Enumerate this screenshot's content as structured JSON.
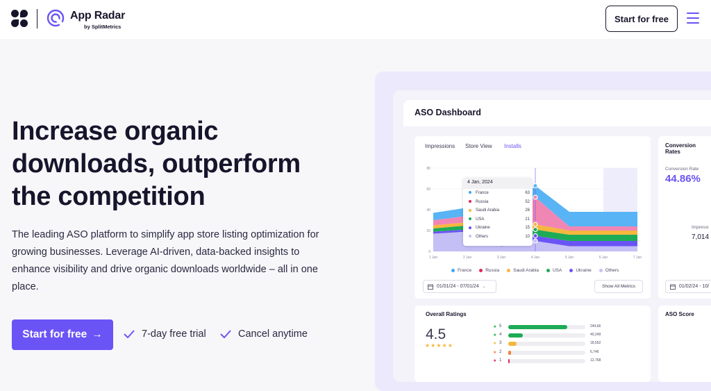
{
  "header": {
    "brand": "App Radar",
    "brand_sub": "by SplitMetrics",
    "cta": "Start for free"
  },
  "hero": {
    "title": "Increase organic downloads, outperform the competition",
    "description": "The leading ASO platform to simplify app store listing optimization for growing businesses. Leverage AI-driven, data-backed insights to enhance visibility and drive organic downloads worldwide – all in one place.",
    "cta": "Start for free",
    "perks": [
      "7-day free trial",
      "Cancel anytime"
    ]
  },
  "dashboard": {
    "title": "ASO Dashboard",
    "tabs": [
      "Impressions",
      "Store View",
      "Installs"
    ],
    "active_tab": "Installs",
    "date_range": "01/01/24 - 07/01/24",
    "show_all": "Show All Metrics",
    "tooltip": {
      "date": "4 Jan, 2024",
      "rows": [
        {
          "label": "France",
          "value": "63",
          "color": "#3da8f5"
        },
        {
          "label": "Russia",
          "value": "52",
          "color": "#e02658"
        },
        {
          "label": "Saudi Arabia",
          "value": "26",
          "color": "#f5b73d"
        },
        {
          "label": "USA",
          "value": "21",
          "color": "#1eab57"
        },
        {
          "label": "Ukraine",
          "value": "15",
          "color": "#6a54f5"
        },
        {
          "label": "Others",
          "value": "10",
          "color": "#c4bff5"
        }
      ]
    },
    "legend": [
      "France",
      "Russia",
      "Saudi Arabia",
      "USA",
      "Ukraine",
      "Others"
    ],
    "conversion": {
      "title": "Conversion Rates",
      "label": "Conversion Rate",
      "value": "44.86%",
      "impressions_label": "Impressi",
      "impressions_value": "7,014",
      "date": "01/02/24 - 10/"
    },
    "ratings": {
      "title": "Overall Ratings",
      "score": "4.5",
      "rows": [
        {
          "stars": "5",
          "count": "244,66",
          "fraction": 0.77,
          "color": "#1eab57"
        },
        {
          "stars": "4",
          "count": "40,249",
          "fraction": 0.19,
          "color": "#1eab57"
        },
        {
          "stars": "3",
          "count": "18,552",
          "fraction": 0.11,
          "color": "#f5b73d"
        },
        {
          "stars": "2",
          "count": "6,746",
          "fraction": 0.04,
          "color": "#f5803d"
        },
        {
          "stars": "1",
          "count": "12,768",
          "fraction": 0.02,
          "color": "#e02658"
        }
      ]
    },
    "aso_score": "ASO Score"
  },
  "chart_data": {
    "type": "area",
    "x": [
      "1 Jan",
      "2 Jan",
      "3 Jan",
      "4 Jan",
      "5 Jan",
      "6 Jan",
      "7 Jan"
    ],
    "yticks": [
      "0",
      "20",
      "40",
      "60",
      "80"
    ],
    "ylim": [
      0,
      80
    ],
    "series": [
      {
        "name": "Others",
        "values": [
          17,
          19,
          5,
          10,
          5,
          5,
          5
        ],
        "color": "#c4bff5"
      },
      {
        "name": "Ukraine",
        "values": [
          2,
          2,
          2,
          5,
          5,
          5,
          5
        ],
        "color": "#6a54f5"
      },
      {
        "name": "USA",
        "values": [
          3,
          4,
          4,
          6,
          6,
          6,
          6
        ],
        "color": "#1eab57"
      },
      {
        "name": "Saudi Arabia",
        "values": [
          3,
          3,
          3,
          5,
          4,
          4,
          4
        ],
        "color": "#f5b73d"
      },
      {
        "name": "Russia",
        "values": [
          5,
          6,
          7,
          26,
          4,
          4,
          4
        ],
        "color": "#f086b4"
      },
      {
        "name": "France",
        "values": [
          7,
          8,
          10,
          11,
          14,
          14,
          14
        ],
        "color": "#58b4f5"
      }
    ]
  }
}
